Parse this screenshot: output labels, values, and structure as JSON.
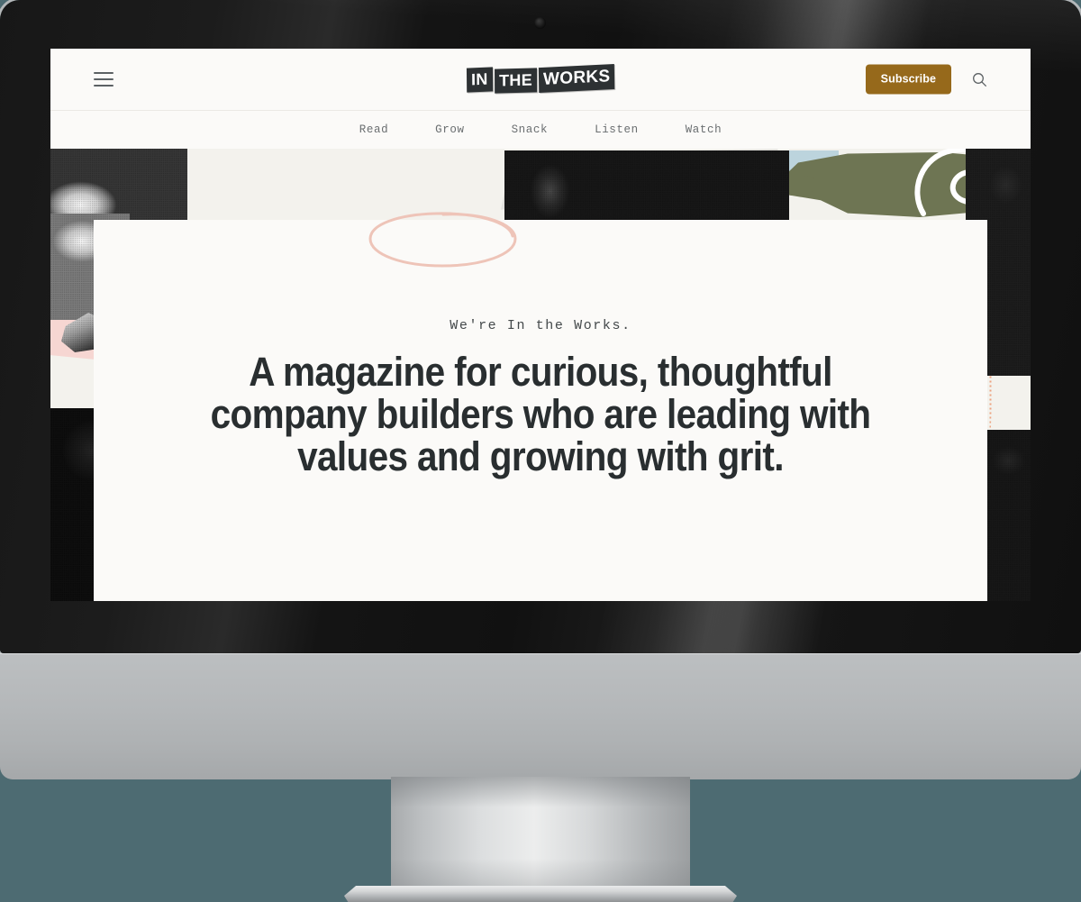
{
  "device": {
    "type": "desktop-monitor",
    "webcam_icon": "camera-dot-icon",
    "bezel_color": "#161616",
    "chin_color": "#b4b7b9",
    "backdrop_color": "#4d6b72"
  },
  "site": {
    "logo_parts": [
      "IN",
      "THE",
      "WORKS"
    ],
    "logo_full": "IN THE WORKS",
    "accent_color": "#96691b",
    "text_color": "#292e30",
    "page_background": "#fbfaf8"
  },
  "header": {
    "menu_icon": "hamburger-menu-icon",
    "subscribe_label": "Subscribe",
    "search_icon": "search-icon"
  },
  "nav": {
    "items": [
      {
        "label": "Read"
      },
      {
        "label": "Grow"
      },
      {
        "label": "Snack"
      },
      {
        "label": "Listen"
      },
      {
        "label": "Watch"
      }
    ]
  },
  "hero": {
    "eyebrow": "We're In the Works.",
    "headline": "A magazine for curious, thoughtful company builders who are leading with values and growing with grit.",
    "highlighted_word": "curious",
    "annotation_shape": "hand-drawn-ellipse",
    "annotation_color": "#eec4b8"
  },
  "collage": {
    "shape_colors": {
      "blue": "#bcd4dd",
      "olive": "#6e7553",
      "pink": "#f6d6d2",
      "gray": "#e3e2de",
      "orange_dots": "#e8733c"
    },
    "photos": [
      {
        "name": "hands-cluster"
      },
      {
        "name": "hands-lower"
      },
      {
        "name": "sneaker"
      },
      {
        "name": "woman-smiling-left"
      },
      {
        "name": "three-people-masked"
      },
      {
        "name": "woman-denim-jacket"
      },
      {
        "name": "person-seated-right"
      }
    ]
  }
}
